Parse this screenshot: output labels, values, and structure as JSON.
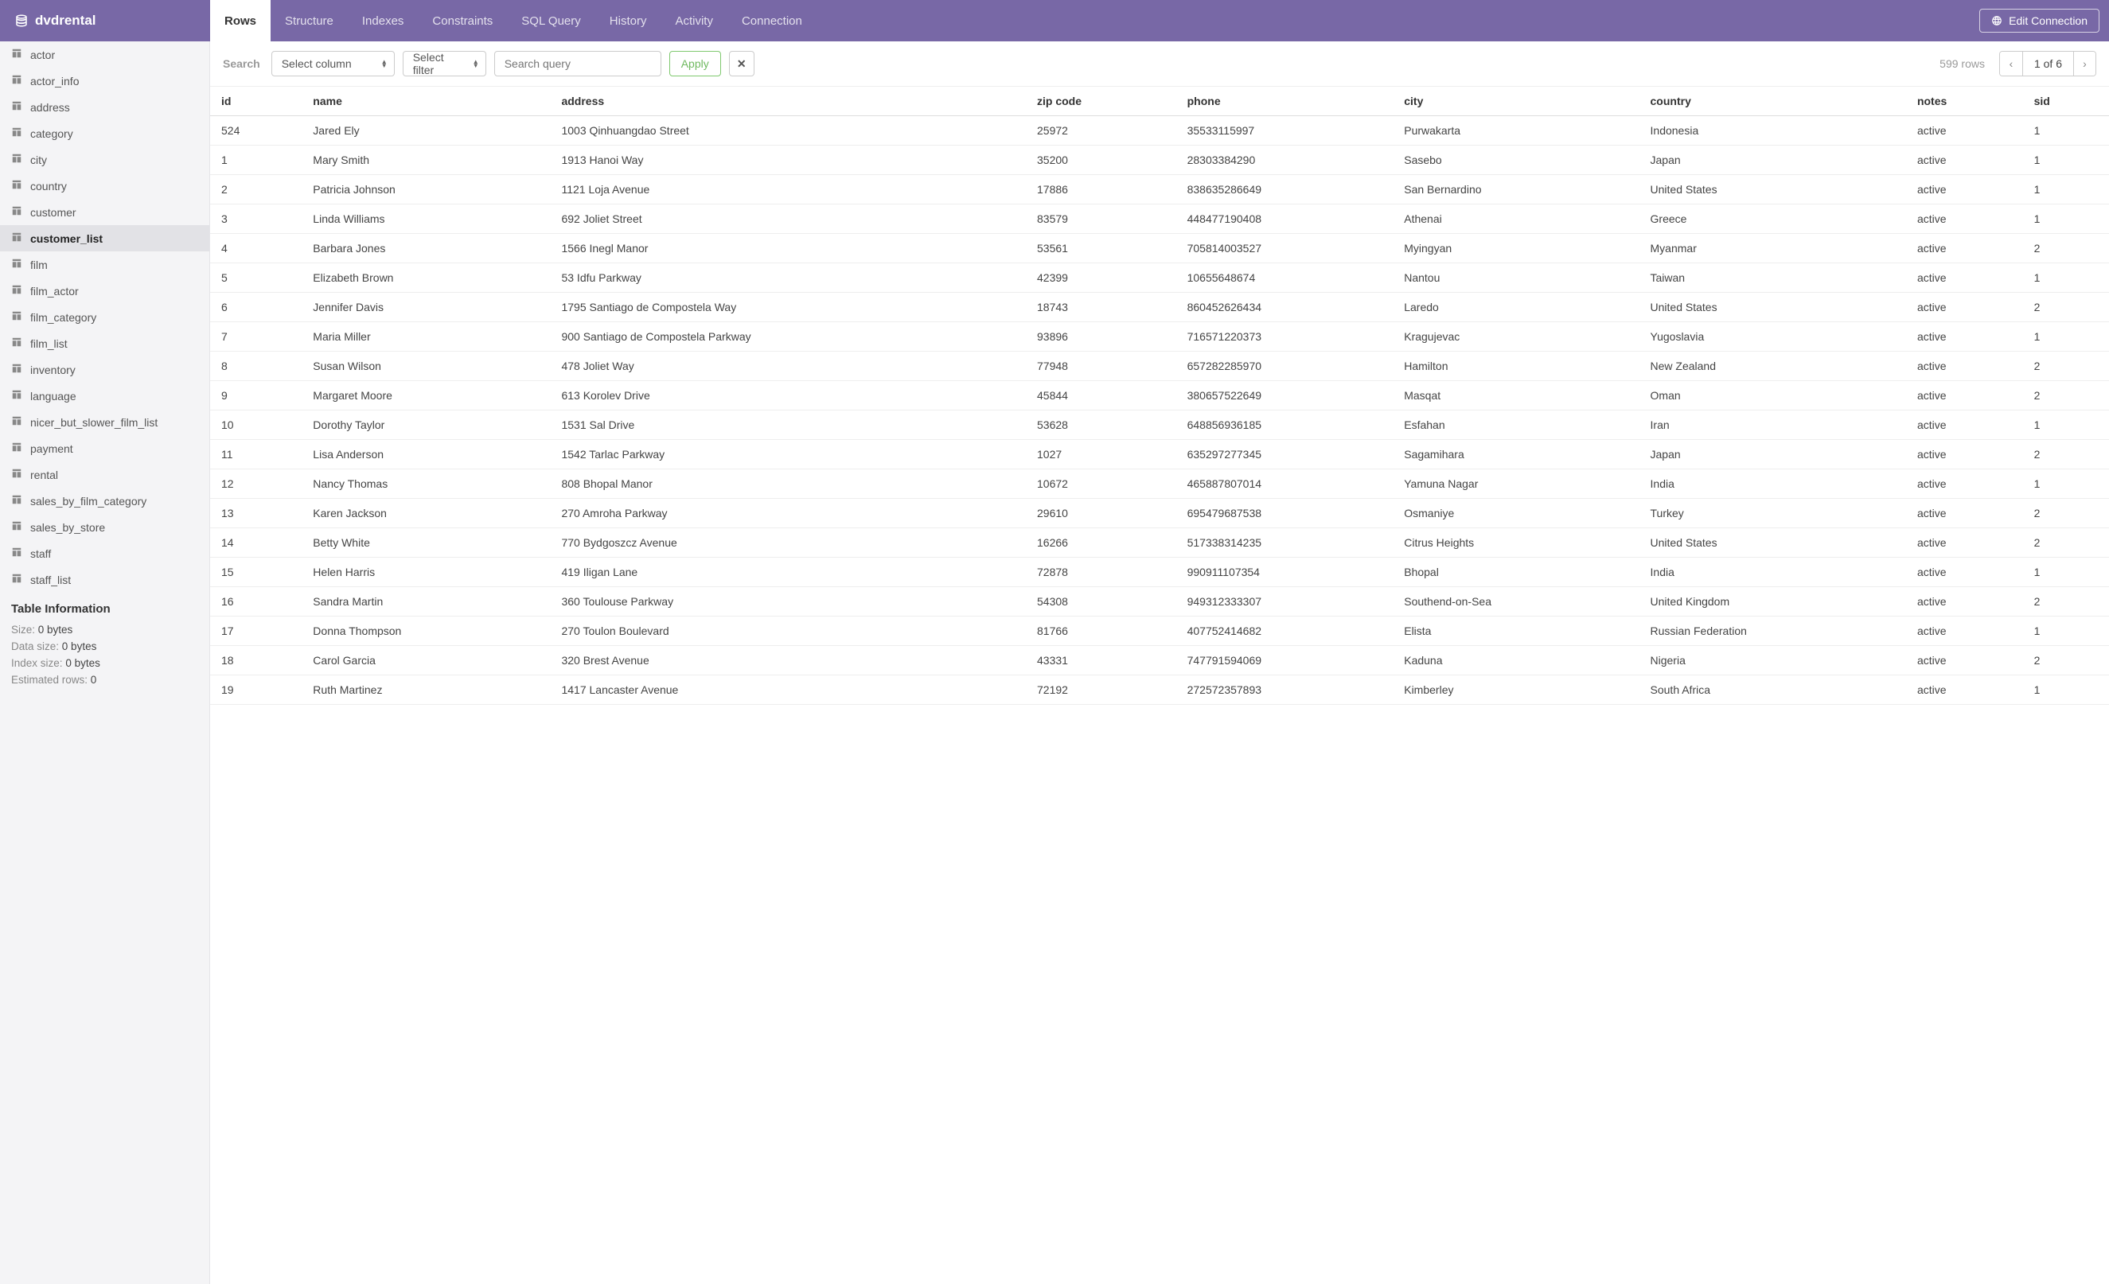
{
  "brand": {
    "name": "dvdrental"
  },
  "topTabs": [
    {
      "label": "Rows",
      "active": true
    },
    {
      "label": "Structure"
    },
    {
      "label": "Indexes"
    },
    {
      "label": "Constraints"
    },
    {
      "label": "SQL Query"
    },
    {
      "label": "History"
    },
    {
      "label": "Activity"
    },
    {
      "label": "Connection"
    }
  ],
  "editConnection": {
    "label": "Edit Connection"
  },
  "sidebar": {
    "tables": [
      {
        "name": "actor"
      },
      {
        "name": "actor_info"
      },
      {
        "name": "address"
      },
      {
        "name": "category"
      },
      {
        "name": "city"
      },
      {
        "name": "country"
      },
      {
        "name": "customer"
      },
      {
        "name": "customer_list",
        "active": true
      },
      {
        "name": "film"
      },
      {
        "name": "film_actor"
      },
      {
        "name": "film_category"
      },
      {
        "name": "film_list"
      },
      {
        "name": "inventory"
      },
      {
        "name": "language"
      },
      {
        "name": "nicer_but_slower_film_list"
      },
      {
        "name": "payment"
      },
      {
        "name": "rental"
      },
      {
        "name": "sales_by_film_category"
      },
      {
        "name": "sales_by_store"
      },
      {
        "name": "staff"
      },
      {
        "name": "staff_list"
      }
    ],
    "info": {
      "heading": "Table Information",
      "size_label": "Size:",
      "size_value": "0 bytes",
      "data_size_label": "Data size:",
      "data_size_value": "0 bytes",
      "index_size_label": "Index size:",
      "index_size_value": "0 bytes",
      "est_rows_label": "Estimated rows:",
      "est_rows_value": "0"
    }
  },
  "toolbar": {
    "search_label": "Search",
    "select_column": "Select column",
    "select_filter": "Select filter",
    "search_placeholder": "Search query",
    "apply": "Apply",
    "rows_count": "599 rows",
    "page_label": "1 of 6"
  },
  "columns": [
    "id",
    "name",
    "address",
    "zip code",
    "phone",
    "city",
    "country",
    "notes",
    "sid"
  ],
  "rows": [
    {
      "id": "524",
      "name": "Jared Ely",
      "address": "1003 Qinhuangdao Street",
      "zip": "25972",
      "phone": "35533115997",
      "city": "Purwakarta",
      "country": "Indonesia",
      "notes": "active",
      "sid": "1"
    },
    {
      "id": "1",
      "name": "Mary Smith",
      "address": "1913 Hanoi Way",
      "zip": "35200",
      "phone": "28303384290",
      "city": "Sasebo",
      "country": "Japan",
      "notes": "active",
      "sid": "1"
    },
    {
      "id": "2",
      "name": "Patricia Johnson",
      "address": "1121 Loja Avenue",
      "zip": "17886",
      "phone": "838635286649",
      "city": "San Bernardino",
      "country": "United States",
      "notes": "active",
      "sid": "1"
    },
    {
      "id": "3",
      "name": "Linda Williams",
      "address": "692 Joliet Street",
      "zip": "83579",
      "phone": "448477190408",
      "city": "Athenai",
      "country": "Greece",
      "notes": "active",
      "sid": "1"
    },
    {
      "id": "4",
      "name": "Barbara Jones",
      "address": "1566 Inegl Manor",
      "zip": "53561",
      "phone": "705814003527",
      "city": "Myingyan",
      "country": "Myanmar",
      "notes": "active",
      "sid": "2"
    },
    {
      "id": "5",
      "name": "Elizabeth Brown",
      "address": "53 Idfu Parkway",
      "zip": "42399",
      "phone": "10655648674",
      "city": "Nantou",
      "country": "Taiwan",
      "notes": "active",
      "sid": "1"
    },
    {
      "id": "6",
      "name": "Jennifer Davis",
      "address": "1795 Santiago de Compostela Way",
      "zip": "18743",
      "phone": "860452626434",
      "city": "Laredo",
      "country": "United States",
      "notes": "active",
      "sid": "2"
    },
    {
      "id": "7",
      "name": "Maria Miller",
      "address": "900 Santiago de Compostela Parkway",
      "zip": "93896",
      "phone": "716571220373",
      "city": "Kragujevac",
      "country": "Yugoslavia",
      "notes": "active",
      "sid": "1"
    },
    {
      "id": "8",
      "name": "Susan Wilson",
      "address": "478 Joliet Way",
      "zip": "77948",
      "phone": "657282285970",
      "city": "Hamilton",
      "country": "New Zealand",
      "notes": "active",
      "sid": "2"
    },
    {
      "id": "9",
      "name": "Margaret Moore",
      "address": "613 Korolev Drive",
      "zip": "45844",
      "phone": "380657522649",
      "city": "Masqat",
      "country": "Oman",
      "notes": "active",
      "sid": "2"
    },
    {
      "id": "10",
      "name": "Dorothy Taylor",
      "address": "1531 Sal Drive",
      "zip": "53628",
      "phone": "648856936185",
      "city": "Esfahan",
      "country": "Iran",
      "notes": "active",
      "sid": "1"
    },
    {
      "id": "11",
      "name": "Lisa Anderson",
      "address": "1542 Tarlac Parkway",
      "zip": "1027",
      "phone": "635297277345",
      "city": "Sagamihara",
      "country": "Japan",
      "notes": "active",
      "sid": "2"
    },
    {
      "id": "12",
      "name": "Nancy Thomas",
      "address": "808 Bhopal Manor",
      "zip": "10672",
      "phone": "465887807014",
      "city": "Yamuna Nagar",
      "country": "India",
      "notes": "active",
      "sid": "1"
    },
    {
      "id": "13",
      "name": "Karen Jackson",
      "address": "270 Amroha Parkway",
      "zip": "29610",
      "phone": "695479687538",
      "city": "Osmaniye",
      "country": "Turkey",
      "notes": "active",
      "sid": "2"
    },
    {
      "id": "14",
      "name": "Betty White",
      "address": "770 Bydgoszcz Avenue",
      "zip": "16266",
      "phone": "517338314235",
      "city": "Citrus Heights",
      "country": "United States",
      "notes": "active",
      "sid": "2"
    },
    {
      "id": "15",
      "name": "Helen Harris",
      "address": "419 Iligan Lane",
      "zip": "72878",
      "phone": "990911107354",
      "city": "Bhopal",
      "country": "India",
      "notes": "active",
      "sid": "1"
    },
    {
      "id": "16",
      "name": "Sandra Martin",
      "address": "360 Toulouse Parkway",
      "zip": "54308",
      "phone": "949312333307",
      "city": "Southend-on-Sea",
      "country": "United Kingdom",
      "notes": "active",
      "sid": "2"
    },
    {
      "id": "17",
      "name": "Donna Thompson",
      "address": "270 Toulon Boulevard",
      "zip": "81766",
      "phone": "407752414682",
      "city": "Elista",
      "country": "Russian Federation",
      "notes": "active",
      "sid": "1"
    },
    {
      "id": "18",
      "name": "Carol Garcia",
      "address": "320 Brest Avenue",
      "zip": "43331",
      "phone": "747791594069",
      "city": "Kaduna",
      "country": "Nigeria",
      "notes": "active",
      "sid": "2"
    },
    {
      "id": "19",
      "name": "Ruth Martinez",
      "address": "1417 Lancaster Avenue",
      "zip": "72192",
      "phone": "272572357893",
      "city": "Kimberley",
      "country": "South Africa",
      "notes": "active",
      "sid": "1"
    }
  ]
}
